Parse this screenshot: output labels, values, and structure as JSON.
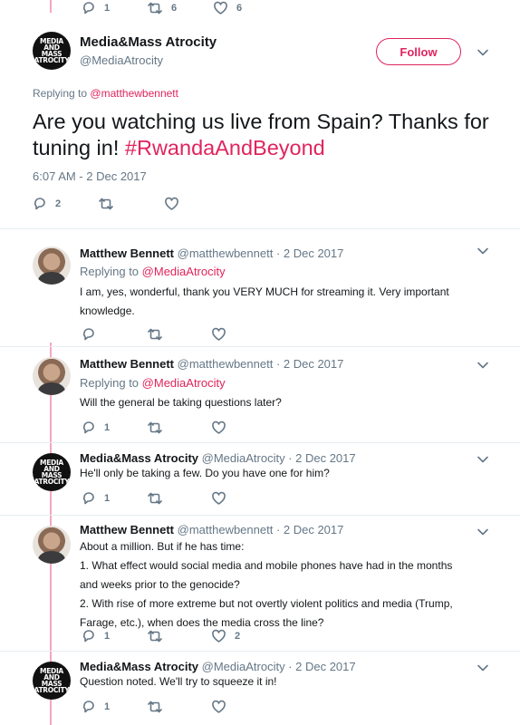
{
  "top_actions": {
    "replies": "1",
    "retweets": "6",
    "likes": "6"
  },
  "main_tweet": {
    "author": "Media&Mass Atrocity",
    "handle": "@MediaAtrocity",
    "avatar_text": [
      "MEDIA",
      "AND MASS",
      "ATROCITY"
    ],
    "follow_label": "Follow",
    "replying_prefix": "Replying to",
    "replying_handle": "@matthewbennett",
    "text": "Are you watching us live from Spain? Thanks for tuning in!",
    "hashtag": "#RwandaAndBeyond",
    "timestamp": "6:07 AM - 2 Dec 2017",
    "replies": "2"
  },
  "replies": [
    {
      "author": "Matthew Bennett",
      "meta": "@matthewbennett · 2 Dec 2017",
      "replying_prefix": "Replying to",
      "replying_handle": "@MediaAtrocity",
      "lines": [
        "I am, yes, wonderful, thank you VERY MUCH for streaming it. Very important",
        "knowledge."
      ],
      "replies": "",
      "likes": ""
    },
    {
      "author": "Matthew Bennett",
      "meta": "@matthewbennett · 2 Dec 2017",
      "replying_prefix": "Replying to",
      "replying_handle": "@MediaAtrocity",
      "lines": [
        "Will the general be taking questions later?"
      ],
      "replies": "1",
      "likes": ""
    },
    {
      "author": "Media&Mass Atrocity",
      "meta": "@MediaAtrocity · 2 Dec 2017",
      "lines": [
        "He'll only be taking a few. Do you have one for him?"
      ],
      "replies": "1",
      "likes": ""
    },
    {
      "author": "Matthew Bennett",
      "meta": "@matthewbennett · 2 Dec 2017",
      "lines": [
        "About a million. But if he has time:",
        "1. What effect would social media and mobile phones have had in the months",
        "and weeks prior to the genocide?",
        "2. With rise of more extreme but not overtly violent politics and media (Trump,",
        "Farage, etc.), when does the media cross the line?"
      ],
      "replies": "1",
      "likes": "2"
    },
    {
      "author": "Media&Mass Atrocity",
      "meta": "@MediaAtrocity · 2 Dec 2017",
      "lines": [
        "Question noted. We'll try to squeeze it in!"
      ],
      "replies": "1",
      "likes": ""
    }
  ],
  "colors": {
    "accent": "#e0245e",
    "thread": "#f4a7c1",
    "muted": "#657786"
  }
}
